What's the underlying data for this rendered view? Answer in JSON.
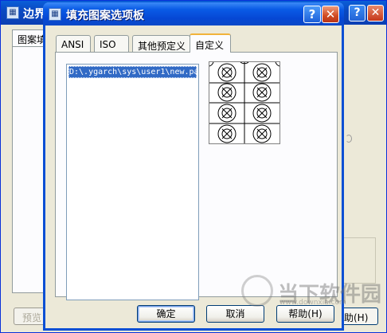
{
  "background_window": {
    "title": "边界",
    "tab_label": "图案填",
    "preview_button": "预览",
    "right_button": "助(H)"
  },
  "dialog": {
    "title": "填充图案选项板",
    "help_glyph": "?",
    "close_glyph": "✕",
    "tabs": [
      {
        "label": "ANSI",
        "active": false
      },
      {
        "label": "ISO",
        "active": false
      },
      {
        "label": "其他预定义",
        "active": false
      },
      {
        "label": "自定义",
        "active": true
      }
    ],
    "file_list": [
      "D:\\.ygarch\\sys\\user1\\new.pa"
    ],
    "buttons": {
      "ok": "确定",
      "cancel": "取消",
      "help": "帮助(H)"
    }
  },
  "watermark": {
    "text": "当下软件园",
    "url": "www.downxia.com"
  },
  "colors": {
    "titlebar": "#0a5be6",
    "selection": "#316ac5",
    "tab_highlight": "#f1b33a",
    "dialog_bg": "#ece9d8"
  }
}
